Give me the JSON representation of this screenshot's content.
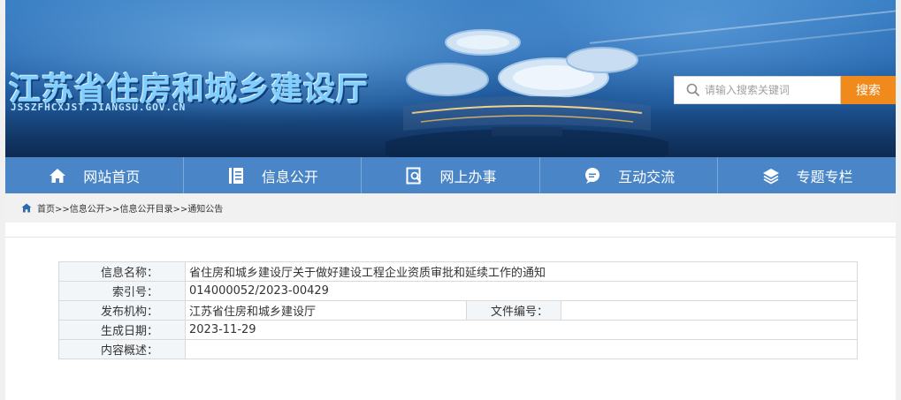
{
  "site": {
    "title_cn": "江苏省住房和城乡建设厅",
    "title_en": "JSSZFHCXJST.JIANGSU.GOV.CN"
  },
  "search": {
    "placeholder": "请输入搜索关键词",
    "button_label": "搜索",
    "icon": "search-icon"
  },
  "nav": {
    "items": [
      {
        "label": "网站首页",
        "icon": "home-icon"
      },
      {
        "label": "信息公开",
        "icon": "document-icon"
      },
      {
        "label": "网上办事",
        "icon": "form-icon"
      },
      {
        "label": "互动交流",
        "icon": "chat-icon"
      },
      {
        "label": "专题专栏",
        "icon": "layers-icon"
      }
    ]
  },
  "breadcrumb": {
    "text": "首页>>信息公开>>信息公开目录>>通知公告",
    "icon": "home-icon"
  },
  "info": {
    "rows": [
      {
        "label": "信息名称：",
        "value": "省住房和城乡建设厅关于做好建设工程企业资质审批和延续工作的通知"
      },
      {
        "label": "索引号：",
        "value": "014000052/2023-00429"
      },
      {
        "label": "发布机构：",
        "value": "江苏省住房和城乡建设厅"
      },
      {
        "label": "生成日期：",
        "value": "2023-11-29"
      },
      {
        "label": "内容概述：",
        "value": ""
      }
    ],
    "doc_number_label": "文件编号：",
    "doc_number_value": ""
  },
  "colors": {
    "nav_bg": "#4a86c7",
    "search_button": "#f08a1c",
    "label_cell_bg": "#f3f6f9"
  }
}
